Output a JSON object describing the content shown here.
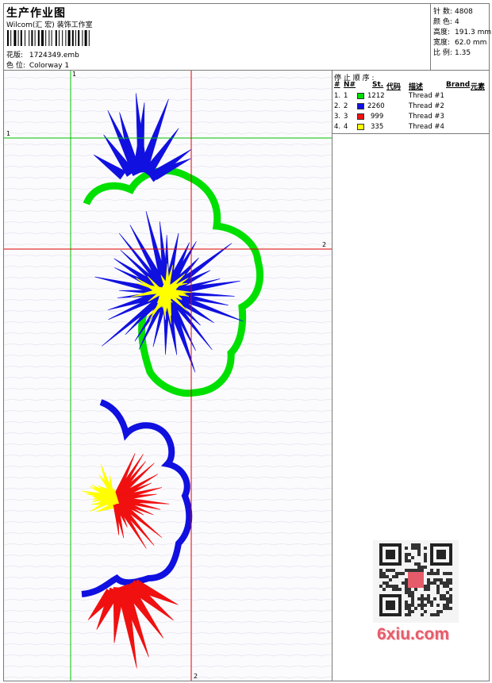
{
  "header": {
    "title": "生产作业图",
    "company": "Wilcom(汇 宏) 装饰工作室",
    "design_label": "花版:",
    "design_value": "1724349.emb",
    "colorway_label": "色 位:",
    "colorway_value": "Colorway 1"
  },
  "stats": [
    {
      "label": "针 数:",
      "value": "4808"
    },
    {
      "label": "颜 色:",
      "value": "4"
    },
    {
      "label": "高度:",
      "value": "191.3 mm"
    },
    {
      "label": "宽度:",
      "value": "62.0 mm"
    },
    {
      "label": "比 例:",
      "value": "1.35"
    }
  ],
  "guides": {
    "label_v1": "1",
    "label_h1": "1",
    "label_h2": "2",
    "label_v2": "2"
  },
  "thread_table": {
    "title": "停 止 顺 序 :",
    "columns": [
      "#",
      "N#",
      "St.",
      "代码",
      "描述",
      "Brand",
      "元素"
    ],
    "rows": [
      {
        "num": "1.",
        "n": "1",
        "stitches": "1212",
        "desc": "Thread #1",
        "color": "#00e000"
      },
      {
        "num": "2.",
        "n": "2",
        "stitches": "2260",
        "desc": "Thread #2",
        "color": "#1010e0"
      },
      {
        "num": "3.",
        "n": "3",
        "stitches": "999",
        "desc": "Thread #3",
        "color": "#f01010"
      },
      {
        "num": "4.",
        "n": "4",
        "stitches": "335",
        "desc": "Thread #4",
        "color": "#ffff00"
      }
    ]
  },
  "colors": {
    "green": "#00e000",
    "blue": "#1010e0",
    "red": "#f01010",
    "yellow": "#ffff00",
    "guide_green": "#00c000",
    "guide_red": "#e00000"
  },
  "watermark": {
    "text": "6xiu.com",
    "icon": "qr-code-icon"
  }
}
